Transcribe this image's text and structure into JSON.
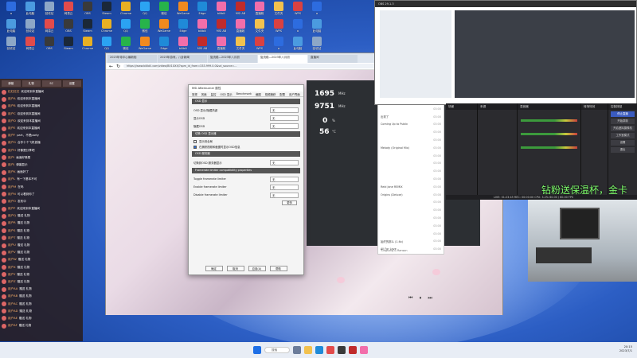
{
  "desktop_icons": [
    {
      "label": "a",
      "color": "#2d6cdf"
    },
    {
      "label": "此电脑",
      "color": "#4b9be0"
    },
    {
      "label": "回收站",
      "color": "#8da7c7"
    },
    {
      "label": "网易云",
      "color": "#e24b4b"
    },
    {
      "label": "OBS",
      "color": "#3a3a3a"
    },
    {
      "label": "Steam",
      "color": "#1b2838"
    },
    {
      "label": "Chrome",
      "color": "#e8b023"
    },
    {
      "label": "QQ",
      "color": "#2ba3f2"
    },
    {
      "label": "微信",
      "color": "#27b34a"
    },
    {
      "label": "WeGame",
      "color": "#f08a1f"
    },
    {
      "label": "Edge",
      "color": "#1f8ad8"
    },
    {
      "label": "bilibili",
      "color": "#f26eaa"
    },
    {
      "label": "MSI AB",
      "color": "#c02b2b"
    },
    {
      "label": "直播姬",
      "color": "#f26eaa"
    },
    {
      "label": "文件夹",
      "color": "#f2c14e"
    },
    {
      "label": "WPS",
      "color": "#d94141"
    }
  ],
  "chat": {
    "tabs": [
      "弹幕",
      "礼物",
      "SC",
      "设置"
    ],
    "messages": [
      {
        "user": "红红红红",
        "text": "欢迎来到本直播间"
      },
      {
        "user": "用户A",
        "text": "欢迎来到本直播间"
      },
      {
        "user": "用户B",
        "text": "欢迎来到本直播间"
      },
      {
        "user": "用户C",
        "text": "欢迎来到本直播间"
      },
      {
        "user": "用户D",
        "text": "欢迎来到本直播间"
      },
      {
        "user": "用户E",
        "text": "欢迎来到本直播间"
      },
      {
        "user": "用户F",
        "text": "part，不是party"
      },
      {
        "user": "用户G",
        "text": "合作十个飞机首播"
      },
      {
        "user": "用户H",
        "text": "好像是分享吧"
      },
      {
        "user": "用户I",
        "text": "画面好像是"
      },
      {
        "user": "用户J",
        "text": "弹幕显示"
      },
      {
        "user": "用户K",
        "text": "画面好了"
      },
      {
        "user": "用户L",
        "text": "有一下基本不可"
      },
      {
        "user": "用户M",
        "text": "在吗"
      },
      {
        "user": "用户N",
        "text": "可以看到你了"
      },
      {
        "user": "用户O",
        "text": "发布中"
      },
      {
        "user": "用户P",
        "text": "欢迎来到本直播间"
      },
      {
        "user": "用户Q",
        "text": "赠送 礼物"
      },
      {
        "user": "用户R",
        "text": "赠送 礼物"
      },
      {
        "user": "用户S",
        "text": "赠送 礼物"
      },
      {
        "user": "用户T",
        "text": "赠送 礼物"
      },
      {
        "user": "用户U",
        "text": "赠送 礼物"
      },
      {
        "user": "用户V",
        "text": "赠送 礼物"
      },
      {
        "user": "用户W",
        "text": "赠送 礼物"
      },
      {
        "user": "用户X",
        "text": "赠送 礼物"
      },
      {
        "user": "用户Y",
        "text": "赠送 礼物"
      },
      {
        "user": "用户Z",
        "text": "赠送 礼物"
      },
      {
        "user": "用户AA",
        "text": "赠送 礼物"
      },
      {
        "user": "用户AB",
        "text": "赠送 礼物"
      },
      {
        "user": "用户AC",
        "text": "赠送 礼物"
      },
      {
        "user": "用户AD",
        "text": "赠送 礼物"
      },
      {
        "user": "用户AE",
        "text": "赠送 礼物"
      },
      {
        "user": "用户AF",
        "text": "赠送 礼物"
      }
    ]
  },
  "browser": {
    "tabs": [
      "2023年帝中心最新相",
      "2023年游戏，八卦新闻",
      "旋流稳—2023年八月初",
      "旋流稳—2023年八月初",
      "直播间"
    ],
    "url": "https://www.bilibili.com/video/BV1XXX/?spm_id_from=333.999.0.0&vd_source=..."
  },
  "overlay": {
    "v1": "1695",
    "u1": "MHz",
    "v2": "9751",
    "u2": "MHz",
    "v3": "0",
    "u3": "%",
    "v4": "56",
    "u4": "°C"
  },
  "msi": {
    "title": "MSI Afterburner 属性",
    "menu": [
      "常规",
      "风扇",
      "监控",
      "OSD 显示",
      "Benchmark",
      "截图",
      "视频捕获",
      "配置",
      "用户界面"
    ],
    "section1": "OSD 显示",
    "rows": [
      {
        "label": "OSD 显示/隐藏热键",
        "value": "无"
      },
      {
        "label": "显示OSD",
        "value": "无"
      },
      {
        "label": "隐藏OSD",
        "value": "无"
      }
    ],
    "section2": "切换 OSD 显示器",
    "checks": [
      {
        "label": "显示到全局",
        "on": false
      },
      {
        "label": "在捕获视频和截图时显示OSD信息",
        "on": true
      }
    ],
    "section3": "OSD 服务器",
    "row4": {
      "label": "切换到OSD 服务器显示",
      "value": "无"
    },
    "section4": "Framerate limiter compatibility properties",
    "rows2": [
      {
        "label": "Toggle framerate limiter",
        "value": "无"
      },
      {
        "label": "Enable framerate limiter",
        "value": "无"
      },
      {
        "label": "Disable framerate limiter",
        "value": "无"
      }
    ],
    "more": "更多",
    "buttons": [
      "确定",
      "取消",
      "应用(A)",
      "帮助"
    ]
  },
  "music": {
    "songs": [
      {
        "t": "",
        "d": "03:00"
      },
      {
        "t": "出现了",
        "d": "03:00"
      },
      {
        "t": "Coming Up to Public",
        "d": "03:00"
      },
      {
        "t": "",
        "d": "03:00"
      },
      {
        "t": "",
        "d": "03:00"
      },
      {
        "t": "Melody (Original Mix)",
        "d": "03:00"
      },
      {
        "t": "",
        "d": "03:00"
      },
      {
        "t": "",
        "d": "03:00"
      },
      {
        "t": "",
        "d": "03:00"
      },
      {
        "t": "",
        "d": "03:00"
      },
      {
        "t": "Reid Jane REMIX",
        "d": "03:00"
      },
      {
        "t": "Origins (Deluxe)",
        "d": "03:00"
      },
      {
        "t": "",
        "d": "03:00"
      },
      {
        "t": "",
        "d": "03:00"
      },
      {
        "t": "",
        "d": "03:00"
      },
      {
        "t": "",
        "d": "03:00"
      },
      {
        "t": "",
        "d": "03:00"
      },
      {
        "t": "始终的那么 (1.6x)",
        "d": "03:00"
      },
      {
        "t": "All For Love",
        "d": "03:00"
      }
    ],
    "bottom": "Tungsung & Ranson"
  },
  "obs": {
    "title": "OBS 29.1.3",
    "panels": [
      "场景",
      "来源",
      "混音器",
      "转场特效",
      "控制按钮"
    ],
    "controls": [
      "停止直播",
      "开始录制",
      "开启虚拟摄像机",
      "工作室模式",
      "设置",
      "退出"
    ],
    "status": "LIVE: 01:23:45   REC: 00:00:00   CPU: 3.2%   60.00 / 60.00 FPS"
  },
  "banner": "钻粉送保温杯，金卡",
  "taskbar": {
    "search": "搜索",
    "time": "20:15",
    "date": "2023/7/1"
  }
}
